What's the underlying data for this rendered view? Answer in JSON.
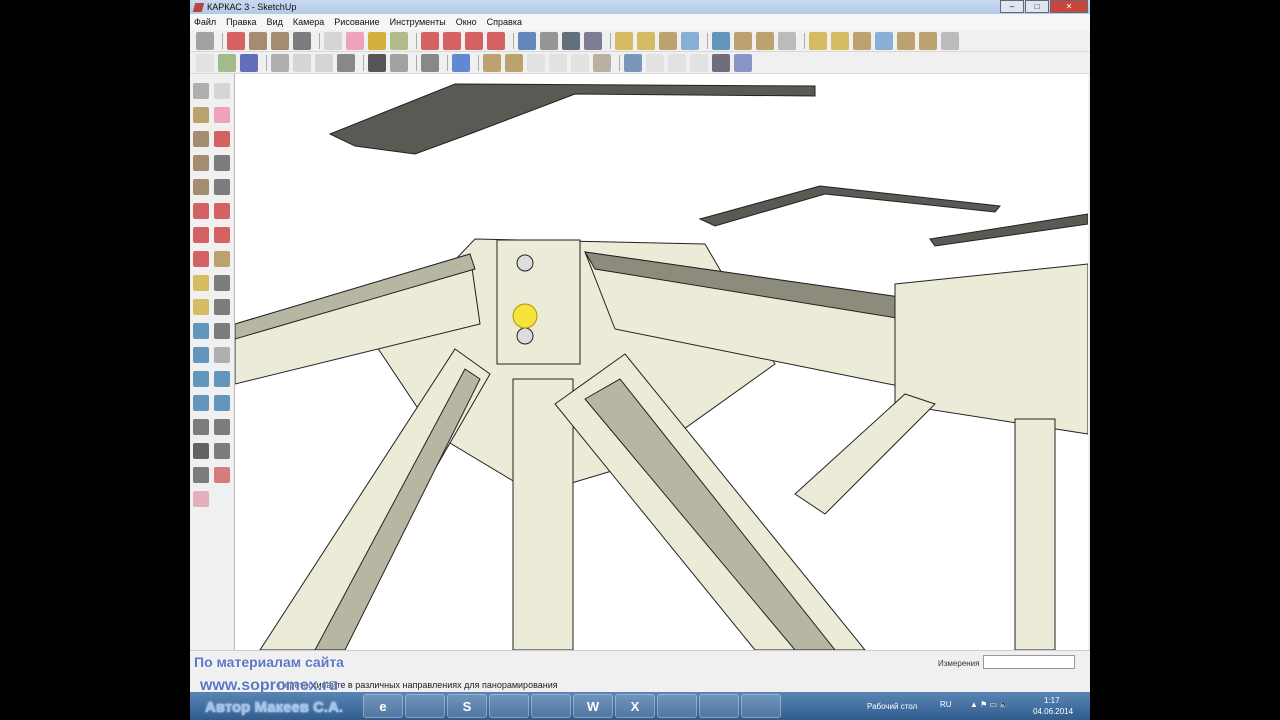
{
  "window": {
    "title": "КАРКАС 3 - SketchUp",
    "minimize": "–",
    "maximize": "□",
    "close": "✕"
  },
  "menu": [
    "Файл",
    "Правка",
    "Вид",
    "Камера",
    "Рисование",
    "Инструменты",
    "Окно",
    "Справка"
  ],
  "status": {
    "hint": "Перетаскивайте в различных направлениях для панорамирования",
    "measurements_label": "Измерения",
    "measurements_value": ""
  },
  "watermark": {
    "line1": "По материалам сайта",
    "line2": "www.sopromex.ru",
    "line3": "Автор Макеев С.А."
  },
  "taskbar": {
    "apps": [
      "e",
      "firefox",
      "S",
      "ccleaner",
      "explorer",
      "W",
      "X",
      "notes",
      "sketchup",
      "camera"
    ],
    "desktop_label": "Рабочий стол",
    "lang": "RU",
    "time": "1:17",
    "date": "04.06.2014"
  },
  "colors": {
    "steel": "#ecebd8",
    "steel_shadow": "#b7b6a3",
    "dark_plate": "#5a5a55"
  }
}
